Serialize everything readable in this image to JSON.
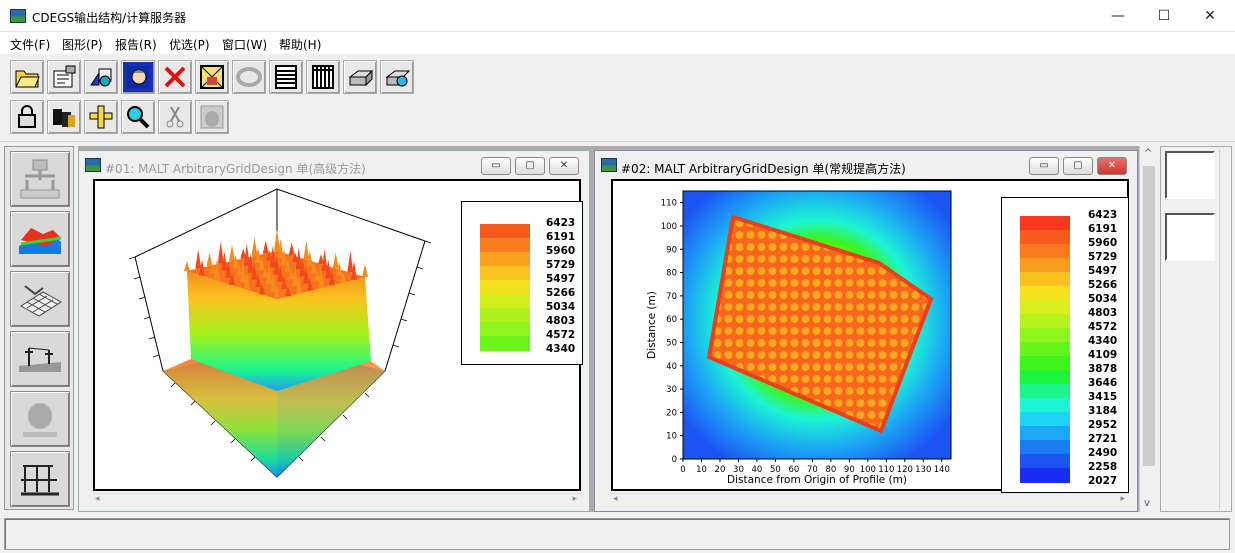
{
  "app": {
    "title": "CDEGS输出结构/计算服务器"
  },
  "window_controls": {
    "minimize": "—",
    "maximize": "☐",
    "close": "✕"
  },
  "menu": [
    "文件(F)",
    "图形(P)",
    "报告(R)",
    "优选(P)",
    "窗口(W)",
    "帮助(H)"
  ],
  "toolbar_row1": [
    "open-folder-icon",
    "properties-icon",
    "shapes-icon",
    "portrait-icon",
    "delete-icon",
    "image-frame-icon",
    "rotate-icon",
    "report-list-icon",
    "report-grid-icon",
    "print-icon",
    "print-preview-icon"
  ],
  "toolbar_row2": [
    "lock-icon",
    "batch-icon",
    "ruler-icon",
    "zoom-icon",
    "cut-icon",
    "tool-icon"
  ],
  "left_toolbar": [
    "fault-source-icon",
    "surface-3d-icon",
    "grid-3d-icon",
    "tower-terrain-icon",
    "ground-icon",
    "substation-icon"
  ],
  "window1": {
    "title": "#01: MALT ArbitraryGridDesign 单(高级方法)",
    "legend": [
      "6423",
      "6191",
      "5960",
      "5729",
      "5497",
      "5266",
      "5034",
      "4803",
      "4572",
      "4340"
    ],
    "colors": [
      "#f45a1c",
      "#f77d1e",
      "#f9a01f",
      "#fbc31f",
      "#f0e01e",
      "#d3ee1e",
      "#b0f11d",
      "#8ef41d",
      "#6cf41b"
    ]
  },
  "window2": {
    "title": "#02: MALT ArbitraryGridDesign 单(常规提高方法)",
    "legend": [
      "6423",
      "6191",
      "5960",
      "5729",
      "5497",
      "5266",
      "5034",
      "4803",
      "4572",
      "4340",
      "4109",
      "3878",
      "3646",
      "3415",
      "3184",
      "2952",
      "2721",
      "2490",
      "2258",
      "2027"
    ],
    "colors": [
      "#f8381c",
      "#f85a1e",
      "#f87c1f",
      "#f99e1f",
      "#f9c01f",
      "#f7e01e",
      "#d9f01e",
      "#b5f41d",
      "#8ff41c",
      "#67f41c",
      "#3ff41c",
      "#1cf43d",
      "#1cf48c",
      "#1cf4d4",
      "#1cd4f4",
      "#1ca6f4",
      "#1c7cf4",
      "#1c54f4",
      "#1c2cf4"
    ],
    "x_label": "Distance from Origin of Profile (m)",
    "y_label": "Distance (m)",
    "x_ticks": [
      "0",
      "10",
      "20",
      "30",
      "40",
      "50",
      "60",
      "70",
      "80",
      "90",
      "100",
      "110",
      "120",
      "130",
      "140"
    ],
    "y_ticks": [
      "0",
      "10",
      "20",
      "30",
      "40",
      "50",
      "60",
      "70",
      "80",
      "90",
      "100",
      "110"
    ]
  },
  "scroll": {
    "up": "^",
    "down": "v"
  }
}
